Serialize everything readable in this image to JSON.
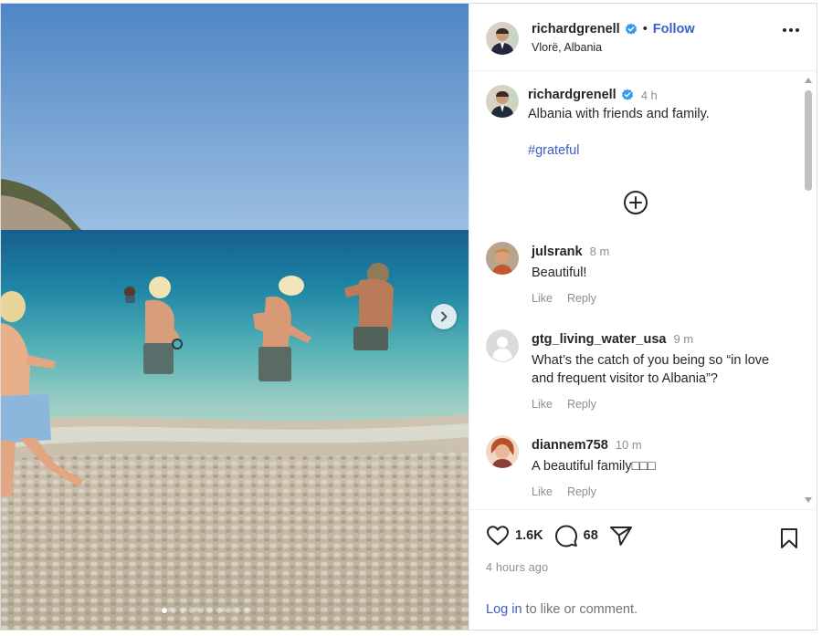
{
  "post": {
    "username": "richardgrenell",
    "follow_label": "Follow",
    "separator": "•",
    "location": "Vlorë, Albania",
    "more_icon": "more-horizontal-icon",
    "verified_icon": "verified-badge-icon",
    "photo": {
      "carousel_next_icon": "chevron-right-icon",
      "slide_count": 10,
      "active_slide": 1
    }
  },
  "caption": {
    "username": "richardgrenell",
    "time": "4 h",
    "text": "Albania with friends and family.",
    "hashtag": "#grateful",
    "load_more_icon": "plus-circle-icon"
  },
  "comments": [
    {
      "username": "julsrank",
      "time": "8 m",
      "text": "Beautiful!",
      "like": "Like",
      "reply": "Reply"
    },
    {
      "username": "gtg_living_water_usa",
      "time": "9 m",
      "text": "What’s the catch of you being so “in love and frequent visitor to Albania”?",
      "like": "Like",
      "reply": "Reply"
    },
    {
      "username": "diannem758",
      "time": "10 m",
      "text": "A beautiful family□□□",
      "like": "Like",
      "reply": "Reply"
    }
  ],
  "actions": {
    "like_icon": "heart-icon",
    "likes": "1.6K",
    "comment_icon": "comment-icon",
    "comments": "68",
    "share_icon": "send-icon",
    "save_icon": "bookmark-icon",
    "posted_ago": "4 hours ago",
    "login_link": "Log in",
    "login_rest": " to like or comment."
  },
  "colors": {
    "link_blue": "#3b5fc7",
    "verified_blue": "#3897f0",
    "muted_text": "#8e8e8e"
  }
}
